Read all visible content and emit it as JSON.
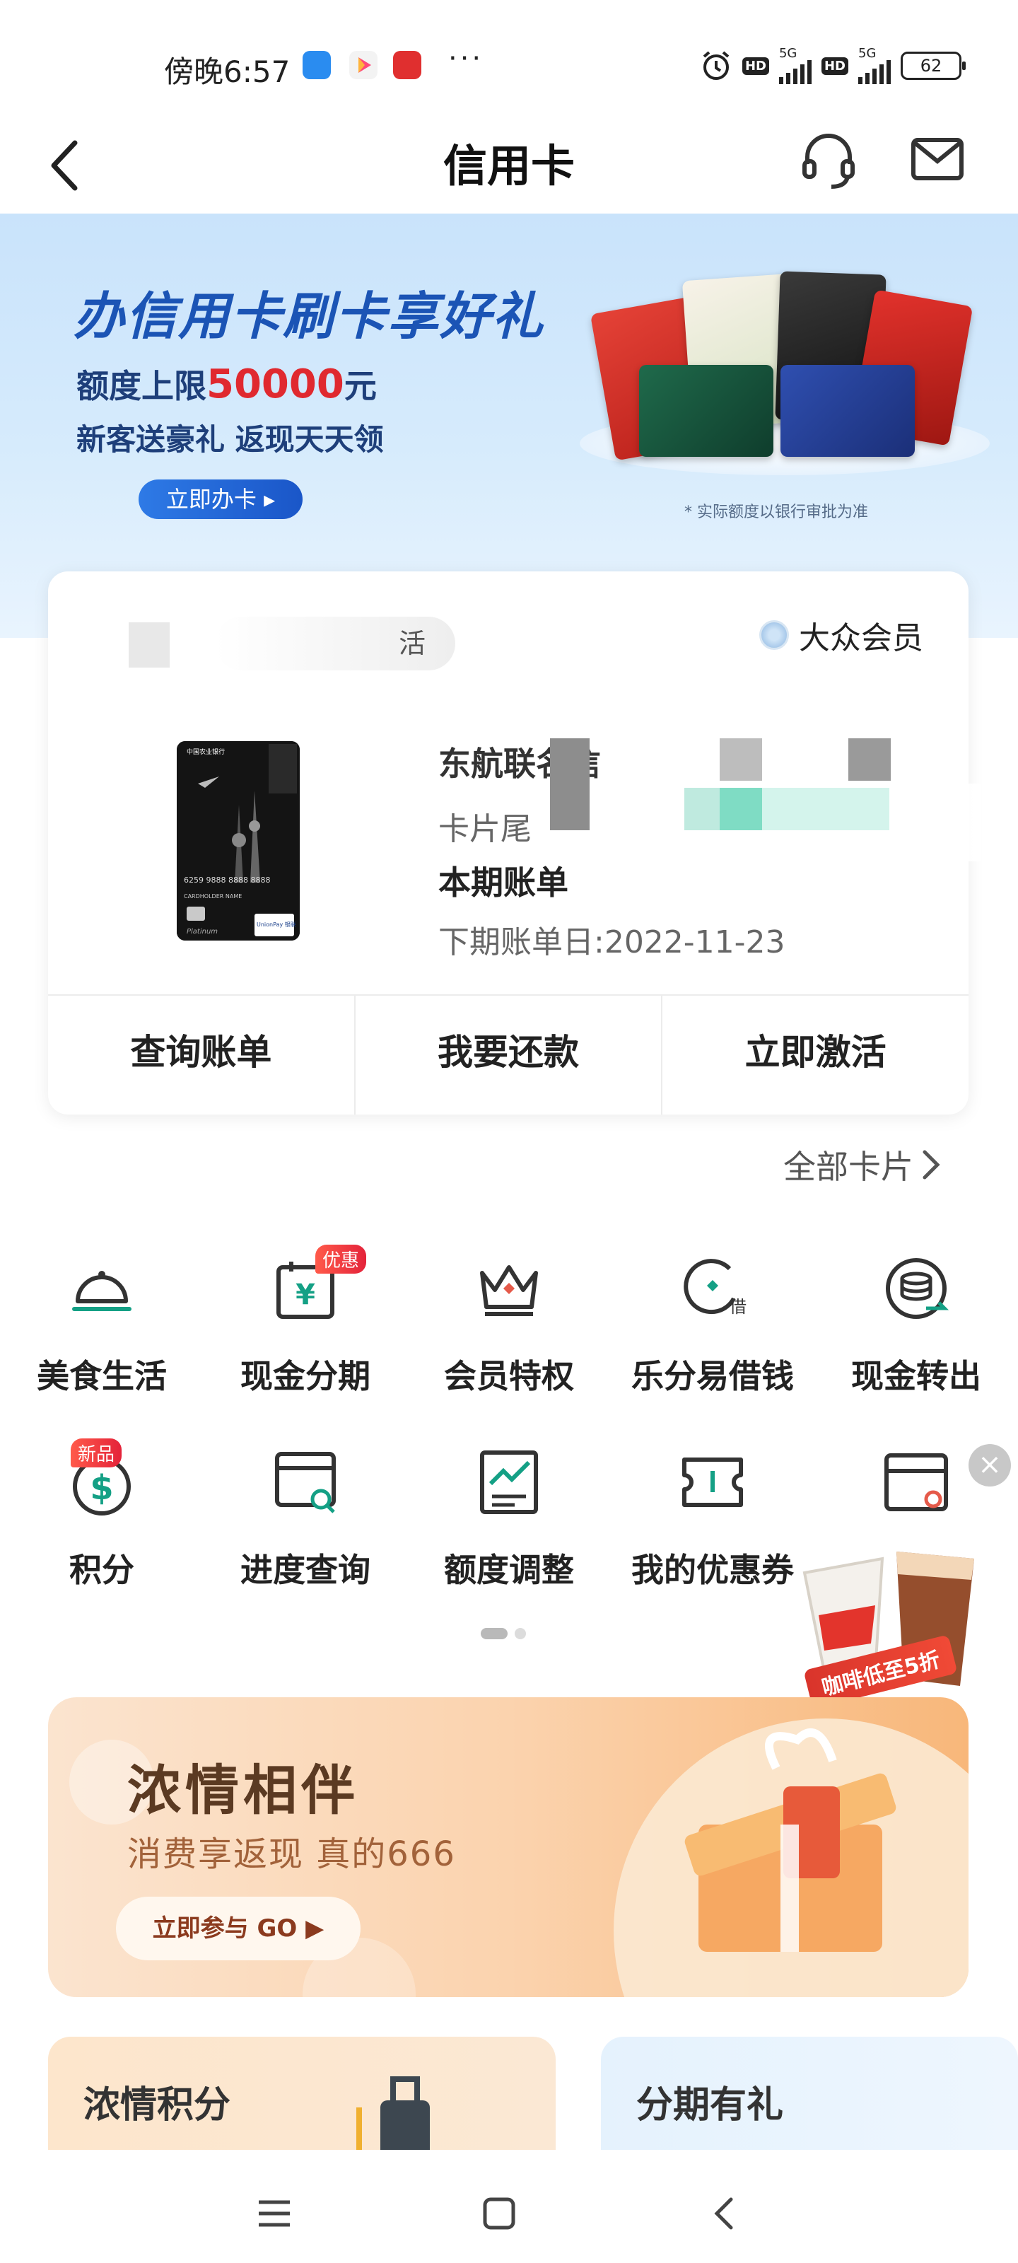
{
  "status_bar": {
    "time": "傍晚6:57",
    "more": "···",
    "net_a": "5G",
    "net_b": "5G",
    "hd": "HD",
    "battery": "62"
  },
  "nav": {
    "title": "信用卡"
  },
  "banner": {
    "title": "办信用卡刷卡享好礼",
    "limit_prefix": "额度上限",
    "limit_amount": "50000",
    "limit_suffix": "元",
    "subtitle": "新客送豪礼  返现天天领",
    "button": "立即办卡",
    "note": "* 实际额度以银行审批为准"
  },
  "account": {
    "chip_text": "活",
    "member_level": "大众会员",
    "card_name": "东航联名信",
    "card_tail": "卡片尾",
    "bill_label": "本期账单",
    "next_bill": "下期账单日:2022-11-23",
    "actions": [
      "查询账单",
      "我要还款",
      "立即激活"
    ],
    "card_face": {
      "bank": "中国农业银行",
      "number": "6259 9888 8888 8888",
      "holder": "CARDHOLDER NAME",
      "tier": "Platinum",
      "network": "UnionPay 银联"
    }
  },
  "all_cards": "全部卡片",
  "services_row1": [
    {
      "label": "美食生活",
      "icon": "food-cloche-icon"
    },
    {
      "label": "现金分期",
      "icon": "cash-installment-icon",
      "badge": "优惠"
    },
    {
      "label": "会员特权",
      "icon": "crown-icon"
    },
    {
      "label": "乐分易借钱",
      "icon": "loan-icon"
    },
    {
      "label": "现金转出",
      "icon": "coins-transfer-icon"
    }
  ],
  "services_row2": [
    {
      "label": "积分",
      "icon": "points-icon",
      "badge": "新品"
    },
    {
      "label": "进度查询",
      "icon": "progress-search-icon"
    },
    {
      "label": "额度调整",
      "icon": "limit-adjust-icon"
    },
    {
      "label": "我的优惠券",
      "icon": "coupon-icon"
    },
    {
      "label": "",
      "icon": "card-settings-icon"
    }
  ],
  "coffee_ad": {
    "tag": "咖啡低至5折",
    "close": "×"
  },
  "promo": {
    "title": "浓情相伴",
    "subtitle": "消费享返现 真的666",
    "button": "立即参与 GO ▶"
  },
  "mini_cards": [
    {
      "title": "浓情积分"
    },
    {
      "title": "分期有礼"
    }
  ],
  "colors": {
    "brand_green": "#14a085",
    "banner_blue": "#1b54b5",
    "red": "#e0292f"
  }
}
